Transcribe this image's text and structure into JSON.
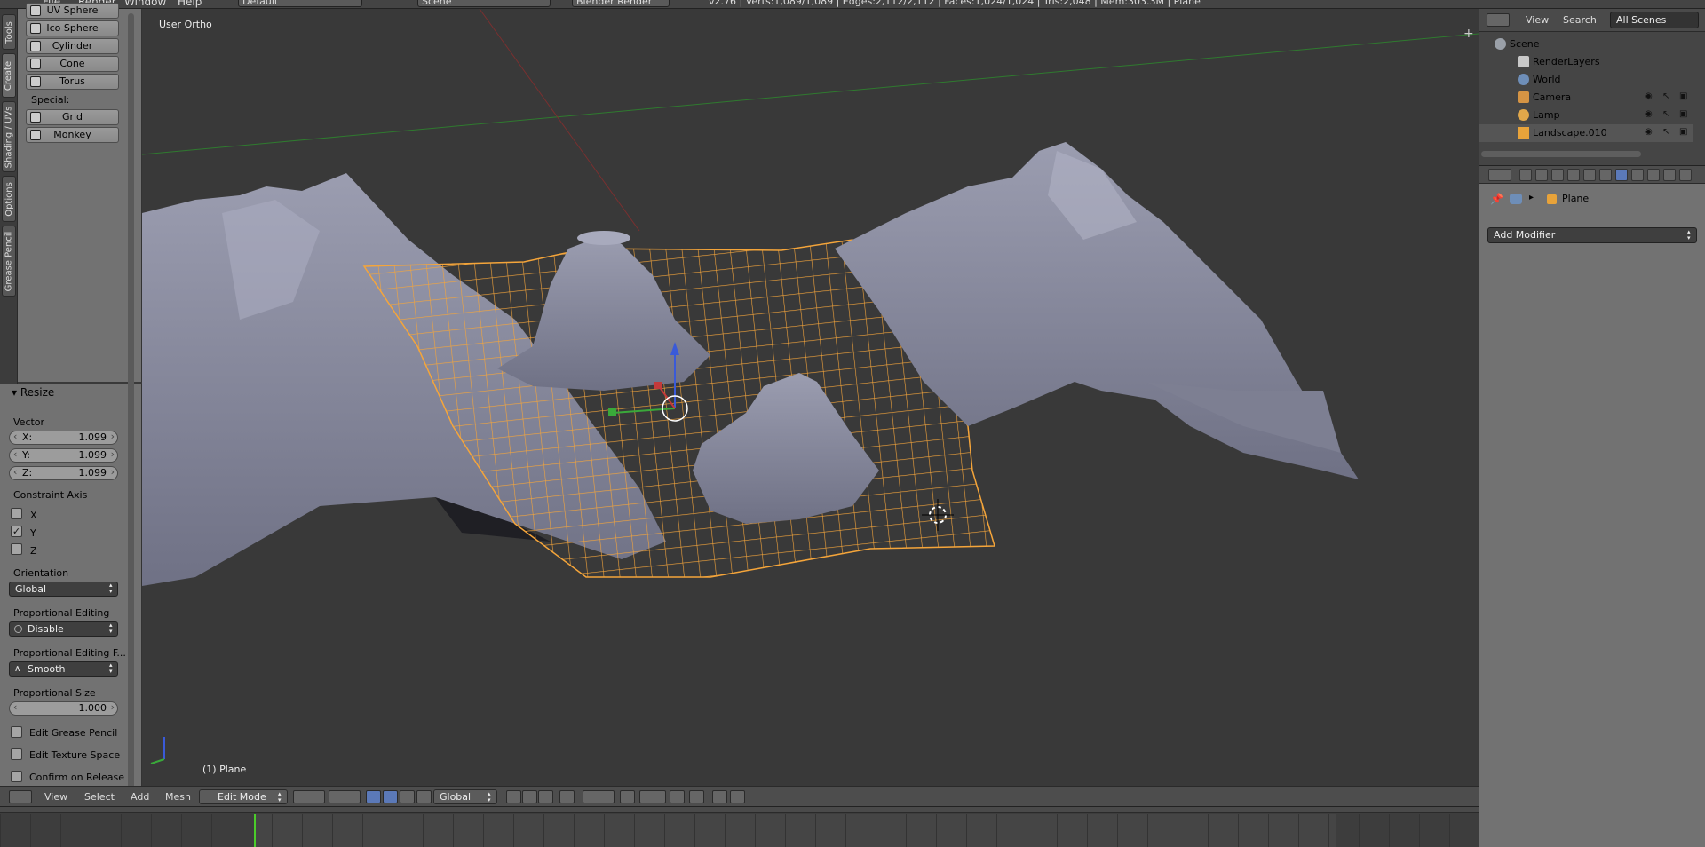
{
  "topbar": {
    "menus": [
      "File",
      "Render",
      "Window",
      "Help"
    ],
    "layout": "Default",
    "scene": "Scene",
    "engine": "Blender Render",
    "stats": "v2.76 | Verts:1,089/1,089 | Edges:2,112/2,112 | Faces:1,024/1,024 | Tris:2,048 | Mem:303.3M | Plane"
  },
  "tabs": [
    "Tools",
    "Create",
    "Shading / UVs",
    "Options",
    "Grease Pencil"
  ],
  "toolshelf": {
    "items": [
      "UV Sphere",
      "Ico Sphere",
      "Cylinder",
      "Cone",
      "Torus"
    ],
    "special_label": "Special:",
    "special": [
      "Grid",
      "Monkey"
    ]
  },
  "redo": {
    "title": "Resize",
    "vector_label": "Vector",
    "vector": [
      {
        "key": "X:",
        "value": "1.099"
      },
      {
        "key": "Y:",
        "value": "1.099"
      },
      {
        "key": "Z:",
        "value": "1.099"
      }
    ],
    "constraint_label": "Constraint Axis",
    "constraint": [
      {
        "label": "X",
        "checked": false
      },
      {
        "label": "Y",
        "checked": true
      },
      {
        "label": "Z",
        "checked": false
      }
    ],
    "orientation_label": "Orientation",
    "orientation": "Global",
    "prop_edit_label": "Proportional Editing",
    "prop_edit": "Disable",
    "prop_falloff_label": "Proportional Editing F...",
    "prop_falloff": "Smooth",
    "prop_size_label": "Proportional Size",
    "prop_size": "1.000",
    "checks": [
      "Edit Grease Pencil",
      "Edit Texture Space",
      "Confirm on Release"
    ]
  },
  "viewport": {
    "view_label": "User Ortho",
    "object_label": "(1) Plane"
  },
  "header3d": {
    "menus": [
      "View",
      "Select",
      "Add",
      "Mesh"
    ],
    "mode": "Edit Mode",
    "orientation": "Global"
  },
  "outliner": {
    "menus": [
      "View",
      "Search"
    ],
    "display": "All Scenes",
    "rows": [
      {
        "label": "Scene",
        "color": "#9aa0a8"
      },
      {
        "label": "RenderLayers",
        "color": "#c8c8c8"
      },
      {
        "label": "World",
        "color": "#6e8eb8"
      },
      {
        "label": "Camera",
        "color": "#d59444"
      },
      {
        "label": "Lamp",
        "color": "#e0a74a"
      },
      {
        "label": "Landscape.010",
        "color": "#e8a33a"
      }
    ]
  },
  "properties": {
    "object": "Plane",
    "add_modifier": "Add Modifier"
  },
  "colors": {
    "mesh_selected": "#f5a53a",
    "terrain": "#8a8c9f",
    "axis_x": "#c33a3a",
    "axis_y": "#3aa93a",
    "axis_z": "#3a5ad8"
  }
}
